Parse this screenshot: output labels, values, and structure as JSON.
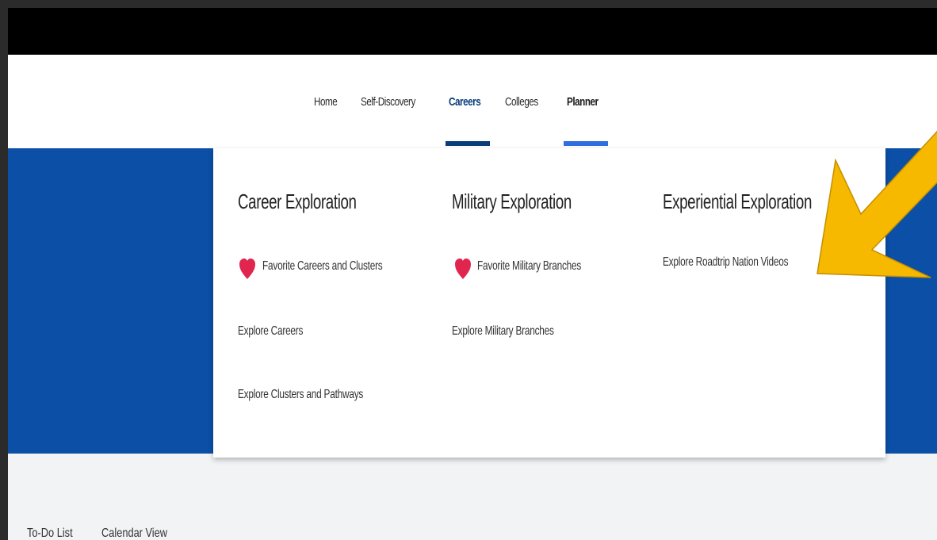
{
  "nav": {
    "items": [
      {
        "label": "Home"
      },
      {
        "label": "Self-Discovery"
      },
      {
        "label": "Careers"
      },
      {
        "label": "Colleges"
      },
      {
        "label": "Planner"
      }
    ]
  },
  "dropdown": {
    "columns": [
      {
        "title": "Career Exploration",
        "items": [
          {
            "label": "Favorite Careers and Clusters",
            "icon": "heart-icon"
          },
          {
            "label": "Explore Careers"
          },
          {
            "label": "Explore Clusters and Pathways"
          }
        ]
      },
      {
        "title": "Military Exploration",
        "items": [
          {
            "label": "Favorite Military Branches",
            "icon": "heart-icon"
          },
          {
            "label": "Explore Military Branches"
          }
        ]
      },
      {
        "title": "Experiential Exploration",
        "items": [
          {
            "label": "Explore Roadtrip Nation Videos"
          }
        ]
      }
    ]
  },
  "sub_tabs": [
    {
      "label": "To-Do List"
    },
    {
      "label": "Calendar View"
    }
  ],
  "colors": {
    "hero": "#0b4fa6",
    "careers_underline": "#0a3d7a",
    "planner_underline": "#2f6fe0",
    "heart": "#e0264e",
    "arrow": "#f7b800"
  }
}
